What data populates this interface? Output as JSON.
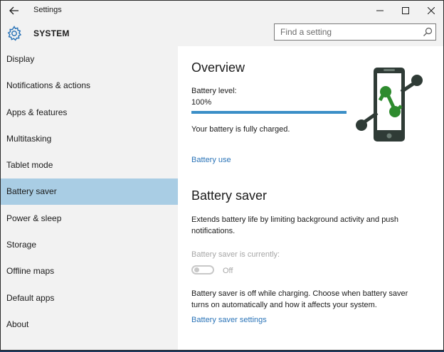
{
  "window": {
    "title": "Settings"
  },
  "header": {
    "section": "SYSTEM",
    "search_placeholder": "Find a setting"
  },
  "sidebar": {
    "items": [
      {
        "label": "Display"
      },
      {
        "label": "Notifications & actions"
      },
      {
        "label": "Apps & features"
      },
      {
        "label": "Multitasking"
      },
      {
        "label": "Tablet mode"
      },
      {
        "label": "Battery saver",
        "selected": true
      },
      {
        "label": "Power & sleep"
      },
      {
        "label": "Storage"
      },
      {
        "label": "Offline maps"
      },
      {
        "label": "Default apps"
      },
      {
        "label": "About"
      }
    ]
  },
  "overview": {
    "heading": "Overview",
    "level_label": "Battery level:",
    "level_value": "100%",
    "level_fraction": 1.0,
    "status": "Your battery is fully charged.",
    "battery_use_link": "Battery use"
  },
  "battery_saver": {
    "heading": "Battery saver",
    "description": "Extends battery life by limiting background activity and push notifications.",
    "currently_label": "Battery saver is currently:",
    "toggle_state": "Off",
    "charging_note": "Battery saver is off while charging. Choose when battery saver turns on automatically and how it affects your system.",
    "settings_link": "Battery saver settings"
  },
  "icons": {
    "back": "back-arrow-icon",
    "minimize": "minimize-icon",
    "maximize": "maximize-icon",
    "close": "close-icon",
    "gear": "gear-icon",
    "search": "search-icon",
    "phone": "phone-illustration-icon"
  },
  "colors": {
    "selected_nav": "#a9cde4",
    "accent": "#3b8fc7",
    "link": "#2b74b8",
    "phone_body": "#2f3b36",
    "phone_accent": "#2e8b2e"
  }
}
